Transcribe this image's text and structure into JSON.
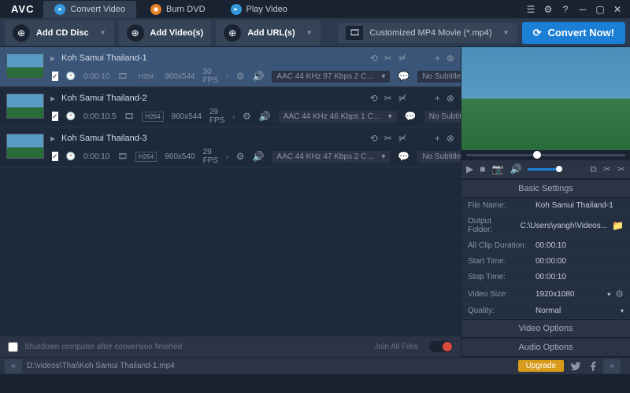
{
  "app": {
    "logo": "AVC"
  },
  "titlebar": {
    "tabs": [
      {
        "icon": "▸",
        "label": "Convert Video",
        "active": true
      },
      {
        "icon": "◉",
        "label": "Burn DVD",
        "orange": true
      },
      {
        "icon": "▸",
        "label": "Play Video"
      }
    ]
  },
  "toolbar": {
    "buttons": [
      {
        "icon": "⊕",
        "label": "Add CD Disc",
        "chev": true
      },
      {
        "icon": "⊕",
        "label": "Add Video(s)"
      },
      {
        "icon": "⊕",
        "label": "Add URL(s)",
        "chev": true
      }
    ],
    "profile": "Customized MP4 Movie (*.mp4)",
    "convert": "Convert Now!"
  },
  "files": [
    {
      "title": "Koh Samui Thailand-1",
      "selected": true,
      "dur": "0:00:10",
      "codec": "H264",
      "res": "960x544",
      "fps": "30 FPS",
      "audio": "AAC 44 KHz 97 Kbps 2 CH ...",
      "sub": "No Subtitle"
    },
    {
      "title": "Koh Samui Thailand-2",
      "dur": "0:00:10.5",
      "codec": "H264",
      "res": "960x544",
      "fps": "29 FPS",
      "audio": "AAC 44 KHz 46 Kbps 1 CH ...",
      "sub": "No Subtitle"
    },
    {
      "title": "Koh Samui Thailand-3",
      "dur": "0:00:10",
      "codec": "H264",
      "res": "960x540",
      "fps": "29 FPS",
      "audio": "AAC 44 KHz 47 Kbps 2 CH ...",
      "sub": "No Subtitle"
    }
  ],
  "shutdown": {
    "label": "Shutdown computer after conversion finished",
    "join": "Join All Files"
  },
  "settings": {
    "header": "Basic Settings",
    "rows": [
      {
        "label": "File Name:",
        "value": "Koh Samui Thailand-1"
      },
      {
        "label": "Output Folder:",
        "value": "C:\\Users\\yangh\\Videos...",
        "browse": true
      },
      {
        "label": "All Clip Duration:",
        "value": "00:00:10"
      },
      {
        "label": "Start Time:",
        "value": "00:00:00"
      },
      {
        "label": "Stop Time:",
        "value": "00:00:10"
      },
      {
        "label": "Video Size:",
        "value": "1920x1080",
        "dd": true,
        "gear": true
      },
      {
        "label": "Quality:",
        "value": "Normal",
        "dd": true
      }
    ],
    "video_options": "Video Options",
    "audio_options": "Audio Options"
  },
  "statusbar": {
    "path": "D:\\videos\\Thai\\Koh Samui Thailand-1.mp4",
    "upgrade": "Upgrade"
  }
}
